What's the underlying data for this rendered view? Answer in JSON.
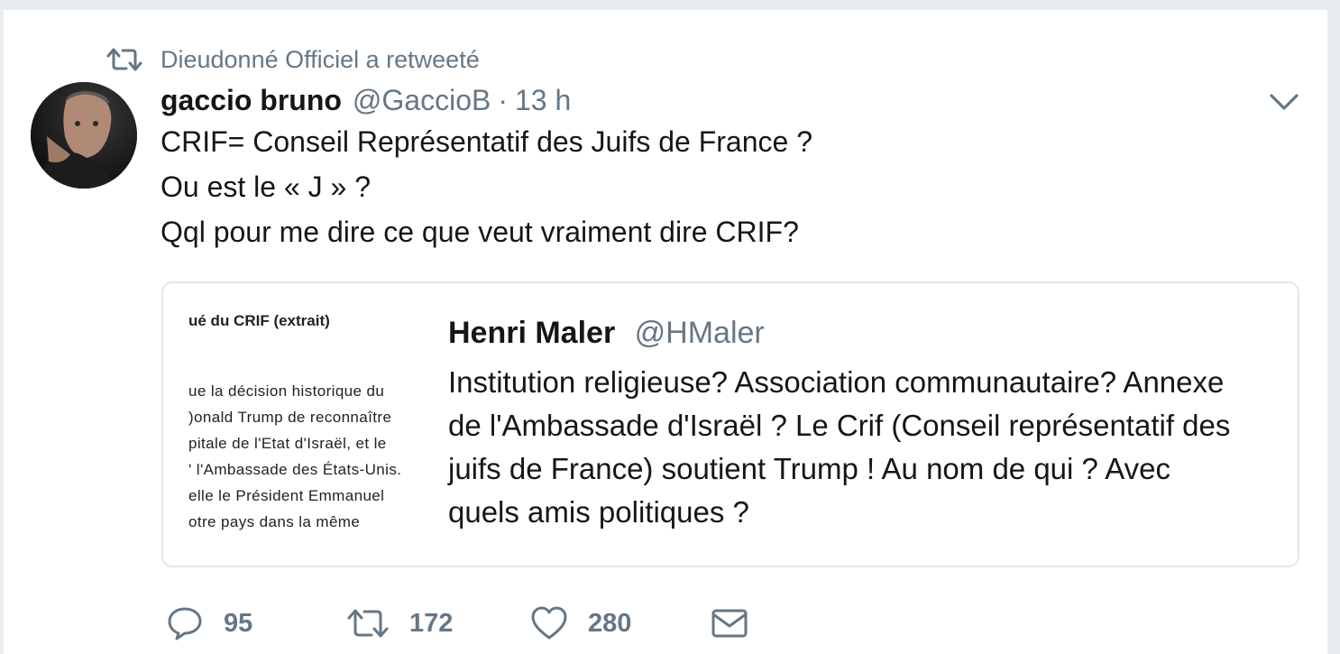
{
  "retweet": {
    "text": "Dieudonné Officiel a retweeté"
  },
  "tweet": {
    "name": "gaccio bruno",
    "handle": "@GaccioB",
    "separator": "·",
    "time": "13 h",
    "lines": [
      "CRIF= Conseil Représentatif des Juifs de France ?",
      "Ou est le « J » ?",
      "Qql pour me dire ce que veut vraiment dire CRIF?"
    ]
  },
  "quoted": {
    "name": "Henri Maler",
    "handle": "@HMaler",
    "lines": [
      "Institution religieuse? Association communautaire? Annexe",
      "de l'Ambassade d'Israël ? Le Crif  (Conseil représentatif des",
      "juifs de France) soutient Trump !  Au nom de qui ? Avec",
      "quels amis politiques ?"
    ],
    "image": {
      "title": "ué du CRIF (extrait)",
      "lines": [
        "ue la décision historique du",
        ")onald Trump de reconnaître",
        "pitale de l'Etat d'Israël, et le",
        "' l'Ambassade des États-Unis.",
        "elle le Président Emmanuel",
        "otre pays dans la même",
        "."
      ]
    }
  },
  "actions": {
    "replies": "95",
    "retweets": "172",
    "likes": "280"
  },
  "colors": {
    "muted": "#657786",
    "text": "#14171a",
    "border": "#e1e8ed",
    "background": "#e6ecf0"
  }
}
